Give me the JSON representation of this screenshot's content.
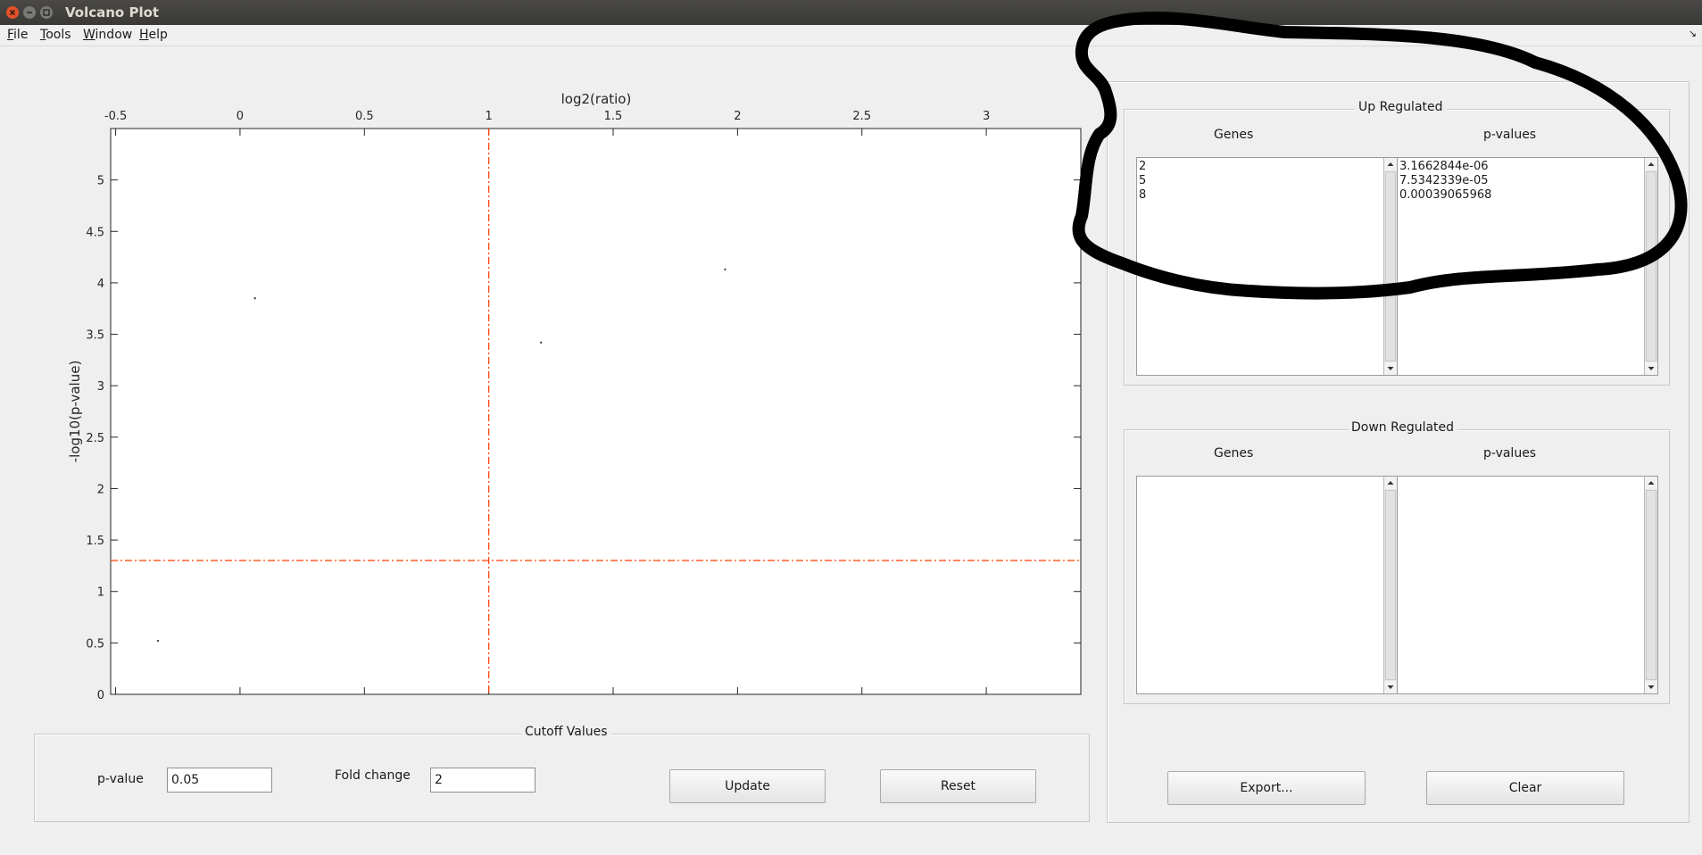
{
  "window": {
    "title": "Volcano Plot"
  },
  "menu": [
    {
      "key": "F",
      "rest": "ile"
    },
    {
      "key": "T",
      "rest": "ools"
    },
    {
      "key": "W",
      "rest": "indow"
    },
    {
      "key": "H",
      "rest": "elp"
    }
  ],
  "chart_data": {
    "type": "scatter",
    "xlabel": "log2(ratio)",
    "ylabel": "-log10(p-value)",
    "xlim": [
      -0.52,
      3.38
    ],
    "ylim": [
      0,
      5.5
    ],
    "x_ticks": [
      "-0.5",
      "0",
      "0.5",
      "1",
      "1.5",
      "2",
      "2.5",
      "3"
    ],
    "y_ticks": [
      "0",
      "0.5",
      "1",
      "1.5",
      "2",
      "2.5",
      "3",
      "3.5",
      "4",
      "4.5",
      "5"
    ],
    "points": [
      {
        "x": 0.06,
        "y": 3.85
      },
      {
        "x": 1.95,
        "y": 4.13
      },
      {
        "x": 1.21,
        "y": 3.42
      },
      {
        "x": -0.33,
        "y": 0.52
      }
    ],
    "cutoff_lines": {
      "x": 1,
      "y": 1.30103,
      "color": "#ff3c00"
    },
    "grid": false
  },
  "cutoff": {
    "title": "Cutoff Values",
    "pvalue_label": "p-value",
    "pvalue": "0.05",
    "fold_label": "Fold change",
    "fold": "2",
    "update": "Update",
    "reset": "Reset"
  },
  "up": {
    "title": "Up Regulated",
    "genes_header": "Genes",
    "pvals_header": "p-values",
    "genes": [
      "2",
      "5",
      "8"
    ],
    "pvalues": [
      "3.1662844e-06",
      "7.5342339e-05",
      "0.00039065968"
    ]
  },
  "down": {
    "title": "Down Regulated",
    "genes_header": "Genes",
    "pvals_header": "p-values",
    "genes": [],
    "pvalues": []
  },
  "actions": {
    "export": "Export...",
    "clear": "Clear"
  }
}
